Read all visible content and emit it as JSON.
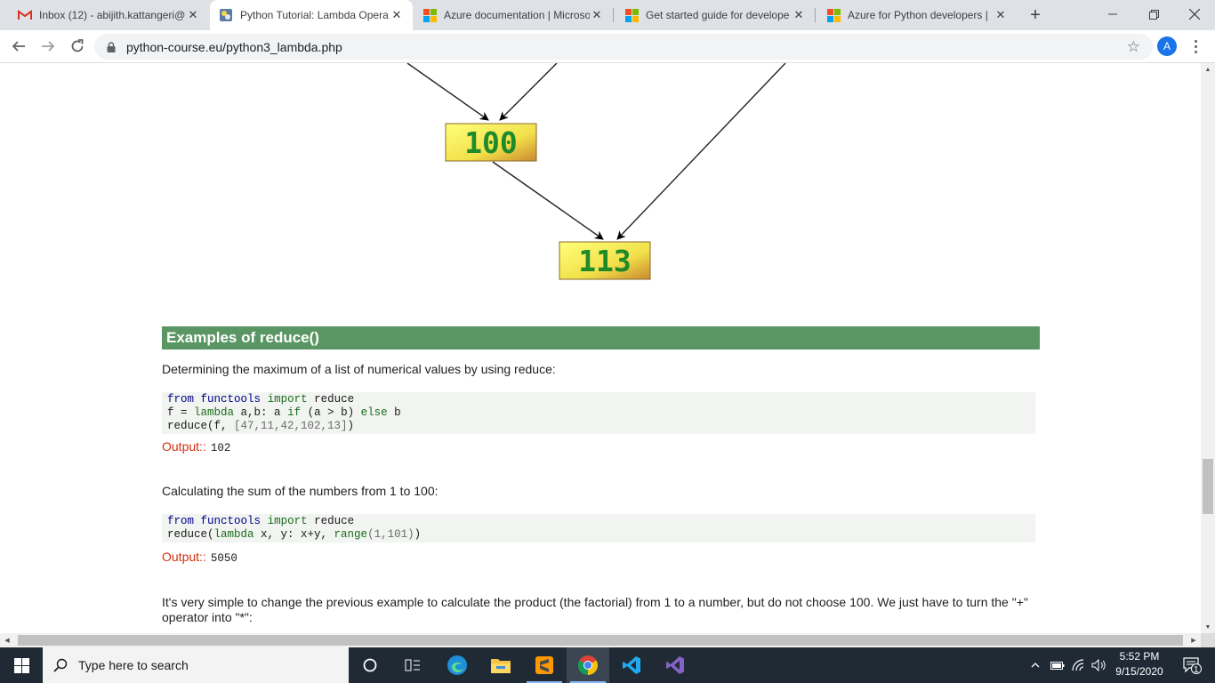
{
  "browser": {
    "tabs": [
      {
        "title": "Inbox (12) - abijith.kattangeri@",
        "icon": "gmail-icon",
        "active": false
      },
      {
        "title": "Python Tutorial: Lambda Opera",
        "icon": "python-course-icon",
        "active": true
      },
      {
        "title": "Azure documentation | Microso",
        "icon": "microsoft-icon",
        "active": false
      },
      {
        "title": "Get started guide for develope",
        "icon": "microsoft-icon",
        "active": false
      },
      {
        "title": "Azure for Python developers | ",
        "icon": "microsoft-icon",
        "active": false
      }
    ],
    "url": "python-course.eu/python3_lambda.php",
    "profile_initial": "A"
  },
  "diagram": {
    "nodes": [
      "100",
      "113"
    ]
  },
  "page": {
    "section_heading": "Examples of reduce()",
    "intro_max": "Determining the maximum of a list of numerical values by using reduce:",
    "code1": {
      "line1": {
        "kw1": "from",
        "mod": "functools",
        "kw2": "import",
        "name": "reduce"
      },
      "line2": {
        "lhs": "f",
        "eq": " = ",
        "lambda": "lambda",
        "args": " a,b: a ",
        "if": "if",
        "cond": " (a > b) ",
        "else": "else",
        "rest": " b"
      },
      "line3": {
        "call": "reduce(f, ",
        "list": "[47,11,42,102,13]",
        "end": ")"
      }
    },
    "output_label": "Output::",
    "output1": "102",
    "intro_sum": "Calculating the sum of the numbers from 1 to 100:",
    "code2": {
      "line1": {
        "kw1": "from",
        "mod": "functools",
        "kw2": "import",
        "name": "reduce"
      },
      "line2": {
        "call": "reduce(",
        "lambda": "lambda",
        "args": " x, y: x+y, ",
        "range": "range",
        "rargs": "(1,101)",
        "end": ")"
      }
    },
    "output2": "5050",
    "intro_product": "It's very simple to change the previous example to calculate the product (the factorial) from 1 to a number, but do not choose 100. We just have to turn the \"+\" operator into \"*\":"
  },
  "taskbar": {
    "search_placeholder": "Type here to search",
    "time": "5:52 PM",
    "date": "9/15/2020",
    "notification_count": "1"
  }
}
